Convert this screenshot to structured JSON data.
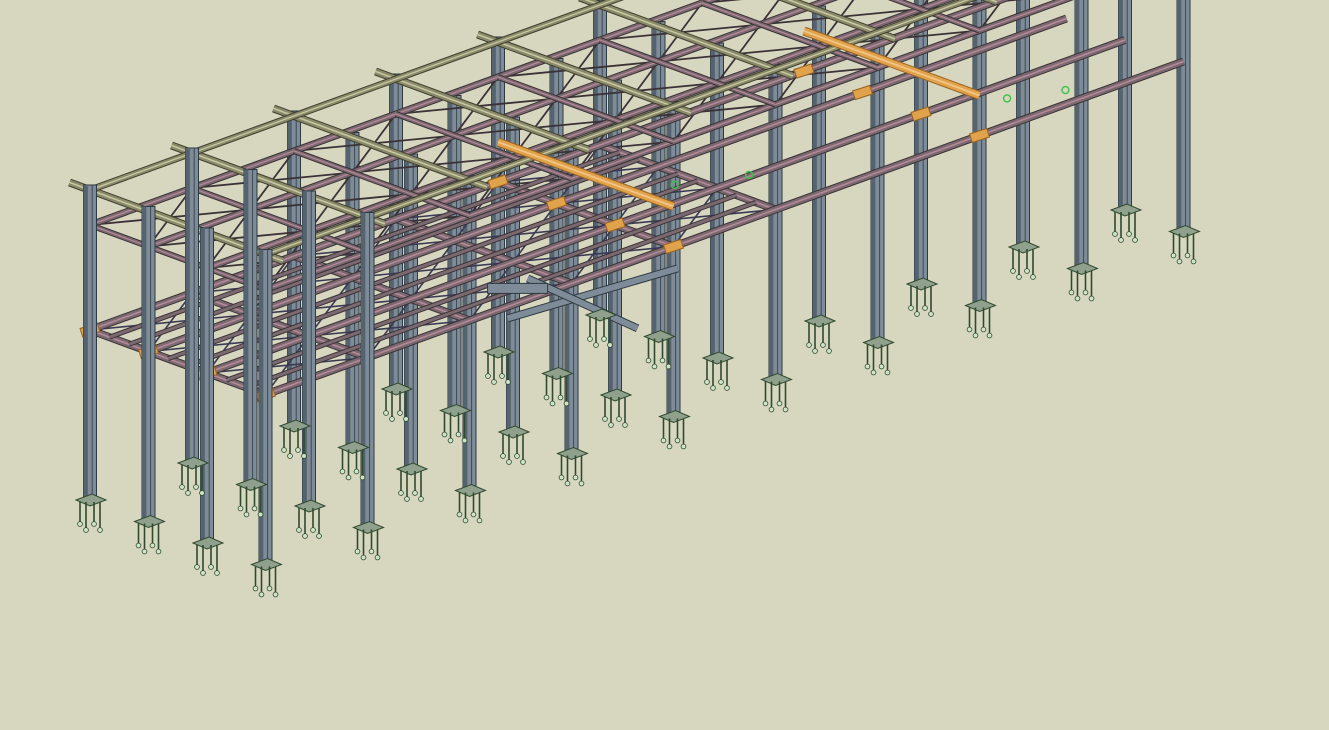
{
  "scene": {
    "description_visible_text": "",
    "background_color": "#d7d6be",
    "colors": {
      "column": "#7d8c98",
      "column_dark": "#55636e",
      "column_edge": "#2e3a42",
      "beam": "#7a6a70",
      "beam_dark": "#3b3238",
      "beam_highlight": "#b8899a",
      "purlin": "#8a8a6a",
      "purlin_edge": "#3f3f2f",
      "connection_plate": "#e0a24a",
      "connection_edge": "#9a6422",
      "bracing": "#3a3a55",
      "baseplate": "#8fa08c",
      "anchor_bolt": "#2f4a2f",
      "bolt_green": "#3ec24a"
    },
    "icons": [
      "steel-column",
      "steel-beam",
      "roof-truss",
      "x-bracing",
      "base-plate",
      "anchor-bolts",
      "connection-plate"
    ]
  }
}
